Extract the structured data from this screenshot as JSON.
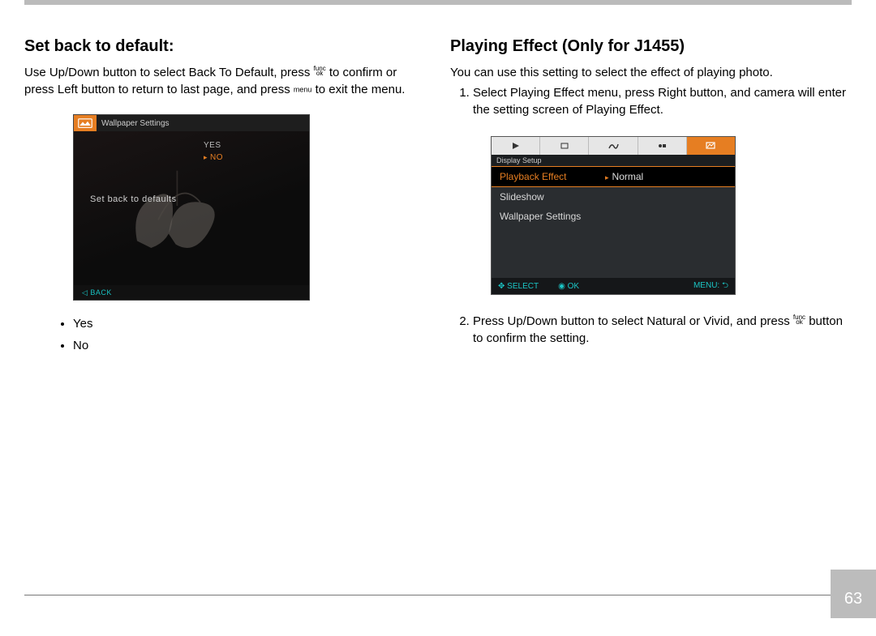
{
  "page_number": "63",
  "left": {
    "heading": "Set back to default:",
    "para_a": "Use Up/Down button to select Back To Default, press ",
    "btn_func_top": "func",
    "btn_func_bot": "ok",
    "para_b": " to confirm or press Left button to return to last page, and press ",
    "btn_menu": "menu",
    "para_c": " to exit the menu.",
    "bullets": [
      "Yes",
      "No"
    ],
    "screenshot": {
      "tab_title": "Wallpaper Settings",
      "opt_yes": "YES",
      "opt_no": "NO",
      "caption": "Set back to defaults",
      "footer_back": "BACK"
    }
  },
  "right": {
    "heading": "Playing Effect (Only for J1455)",
    "intro": "You can use this setting to select the effect of playing photo.",
    "step1": "Select Playing Effect menu, press Right button, and camera will enter the setting screen of Playing Effect.",
    "step2_a": "Press Up/Down button to select Natural or Vivid, and press ",
    "btn_func_top": "func",
    "btn_func_bot": "ok",
    "step2_b": " button to confirm the setting.",
    "screenshot": {
      "crumb": "Display Setup",
      "row1_label": "Playback Effect",
      "row1_value": "Normal",
      "row2_label": "Slideshow",
      "row3_label": "Wallpaper Settings",
      "footer_select": "SELECT",
      "footer_ok": "OK",
      "footer_menu": "MENU:"
    }
  }
}
